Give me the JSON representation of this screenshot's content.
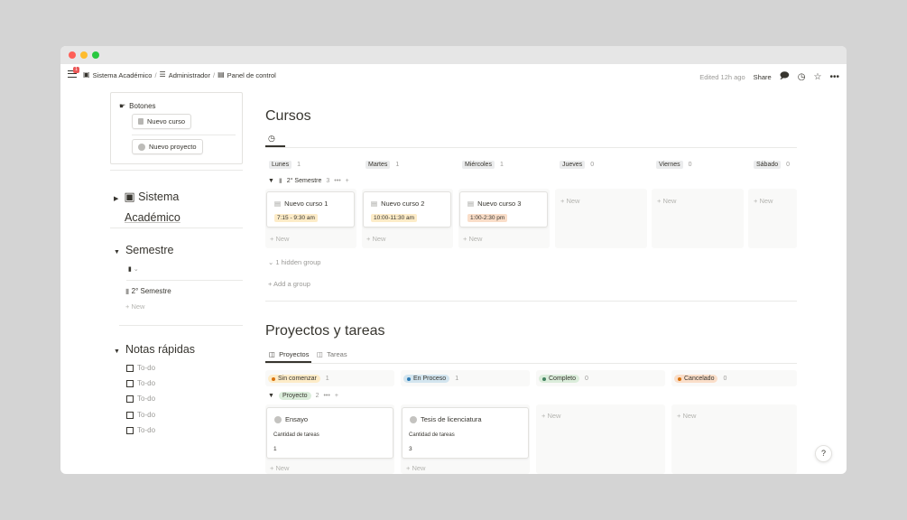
{
  "breadcrumb": {
    "notification_count": "1",
    "item1": "Sistema Académico",
    "item2": "Administrador",
    "item3": "Panel de control",
    "separator": "/"
  },
  "topbar": {
    "edited": "Edited 12h ago",
    "share": "Share"
  },
  "left": {
    "botones_title": "Botones",
    "btn_nuevo_curso": "Nuevo curso",
    "btn_nuevo_proyecto": "Nuevo proyecto",
    "sistema_line1": "Sistema",
    "sistema_line2": "Académico",
    "semestre_title": "Semestre",
    "semestre_item": "2° Semestre",
    "semestre_new": "+ New",
    "notas_title": "Notas rápidas",
    "todos": [
      "To-do",
      "To-do",
      "To-do",
      "To-do",
      "To-do"
    ]
  },
  "cursos": {
    "title": "Cursos",
    "columns": [
      {
        "label": "Lunes",
        "count": "1"
      },
      {
        "label": "Martes",
        "count": "1"
      },
      {
        "label": "Miércoles",
        "count": "1"
      },
      {
        "label": "Jueves",
        "count": "0"
      },
      {
        "label": "Viernes",
        "count": "0"
      },
      {
        "label": "Sábado",
        "count": "0"
      }
    ],
    "group_label": "2° Semestre",
    "group_count": "3",
    "cards": [
      {
        "title": "Nuevo curso 1",
        "time": "7:15 - 9:30 am"
      },
      {
        "title": "Nuevo curso 2",
        "time": "10:00-11:30 am"
      },
      {
        "title": "Nuevo curso 3",
        "time": "1:00-2:30 pm"
      }
    ],
    "new_label": "+ New",
    "hidden_group": "1 hidden group",
    "add_group": "+ Add a group"
  },
  "proyectos": {
    "title": "Proyectos y tareas",
    "tab1": "Proyectos",
    "tab2": "Tareas",
    "columns": [
      {
        "label": "Sin comenzar",
        "count": "1",
        "bg": "#fdecc8",
        "dot": "#d9730d"
      },
      {
        "label": "En Proceso",
        "count": "1",
        "bg": "#d3e5ef",
        "dot": "#2e7bb4"
      },
      {
        "label": "Completo",
        "count": "0",
        "bg": "#dbeddb",
        "dot": "#448361"
      },
      {
        "label": "Cancelado",
        "count": "0",
        "bg": "#fadec9",
        "dot": "#d9730d"
      }
    ],
    "group_label": "Proyecto",
    "group_count": "2",
    "cards": [
      {
        "title": "Ensayo",
        "prop": "Cantidad de tareas",
        "value": "1"
      },
      {
        "title": "Tesis de licenciatura",
        "prop": "Cantidad de tareas",
        "value": "3"
      }
    ],
    "new_label": "+ New"
  },
  "help": "?"
}
